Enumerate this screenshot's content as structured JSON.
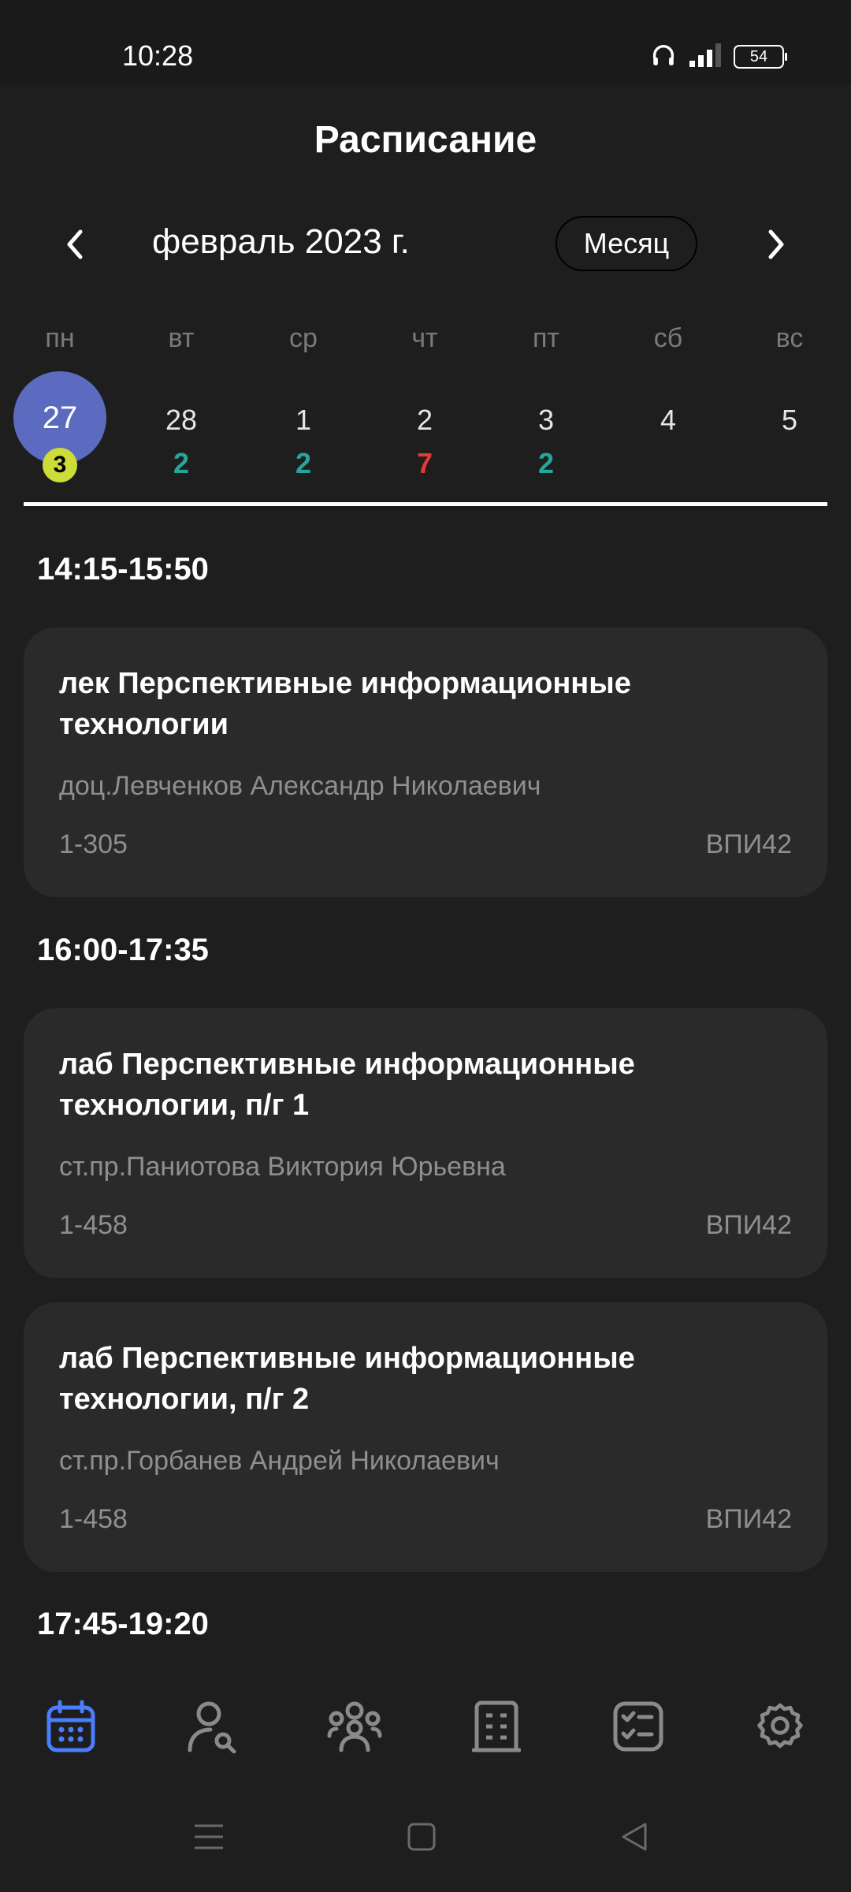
{
  "status_bar": {
    "time": "10:28",
    "battery": "54",
    "icons": [
      "headphones-icon",
      "signal-icon",
      "battery-icon"
    ]
  },
  "header": {
    "title": "Расписание"
  },
  "calendar": {
    "month": "февраль 2023 г.",
    "mode_button": "Месяц",
    "weekdays": [
      "пн",
      "вт",
      "ср",
      "чт",
      "пт",
      "сб",
      "вс"
    ],
    "days": [
      {
        "num": "27",
        "count": "3",
        "selected": true
      },
      {
        "num": "28",
        "count": "2",
        "count_color": "#26a69a"
      },
      {
        "num": "1",
        "count": "2",
        "count_color": "#26a69a"
      },
      {
        "num": "2",
        "count": "7",
        "count_color": "#e53935"
      },
      {
        "num": "3",
        "count": "2",
        "count_color": "#26a69a"
      },
      {
        "num": "4",
        "count": ""
      },
      {
        "num": "5",
        "count": ""
      }
    ]
  },
  "schedule": {
    "slot1": {
      "time": "14:15-15:50",
      "lessons": [
        {
          "subject": "лек Перспективные информационные технологии",
          "teacher": "доц.Левченков Александр Николаевич",
          "room": "1-305",
          "group": "ВПИ42"
        }
      ]
    },
    "slot2": {
      "time": "16:00-17:35",
      "lessons": [
        {
          "subject": "лаб Перспективные информационные технологии, п/г 1",
          "teacher": "ст.пр.Паниотова Виктория Юрьевна",
          "room": "1-458",
          "group": "ВПИ42"
        },
        {
          "subject": "лаб Перспективные информационные технологии, п/г 2",
          "teacher": "ст.пр.Горбанев Андрей Николаевич",
          "room": "1-458",
          "group": "ВПИ42"
        }
      ]
    },
    "slot3": {
      "time": "17:45-19:20"
    }
  },
  "bottom_nav": {
    "items": [
      "calendar-icon",
      "teacher-search-icon",
      "groups-icon",
      "building-icon",
      "checklist-icon",
      "settings-icon"
    ],
    "active_color": "#4a7dff",
    "inactive_color": "#8a8a8a"
  },
  "colors": {
    "background": "#1e1e1e",
    "card": "#2a2a2a",
    "selected_day": "#5c6bc0",
    "badge": "#cddc39"
  }
}
